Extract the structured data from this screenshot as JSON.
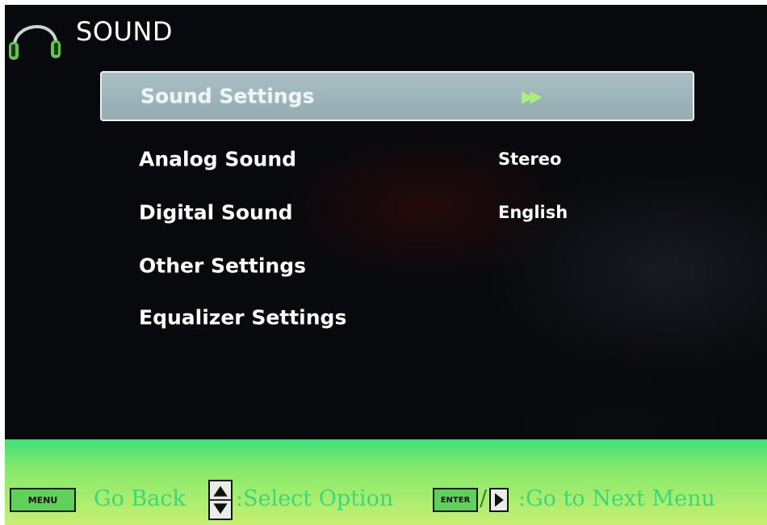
{
  "header": {
    "title": "SOUND",
    "icon": "headphones-icon"
  },
  "menu": {
    "items": [
      {
        "label": "Sound Settings",
        "value": "▶▶",
        "selected": true
      },
      {
        "label": "Analog Sound",
        "value": "Stereo"
      },
      {
        "label": "Digital Sound",
        "value": "English"
      },
      {
        "label": "Other Settings",
        "value": ""
      },
      {
        "label": "Equalizer Settings",
        "value": ""
      }
    ]
  },
  "footer": {
    "menu_key": "MENU",
    "go_back": "Go Back",
    "select_option": ":Select Option",
    "enter_key": "ENTER",
    "slash": "/",
    "go_next": ":Go to Next Menu"
  },
  "colors": {
    "selection": "#a9bfc4",
    "footer_bar": "#86ea6a",
    "footer_text": "#2fd67a",
    "arrow_indicator": "#a9f07a"
  }
}
